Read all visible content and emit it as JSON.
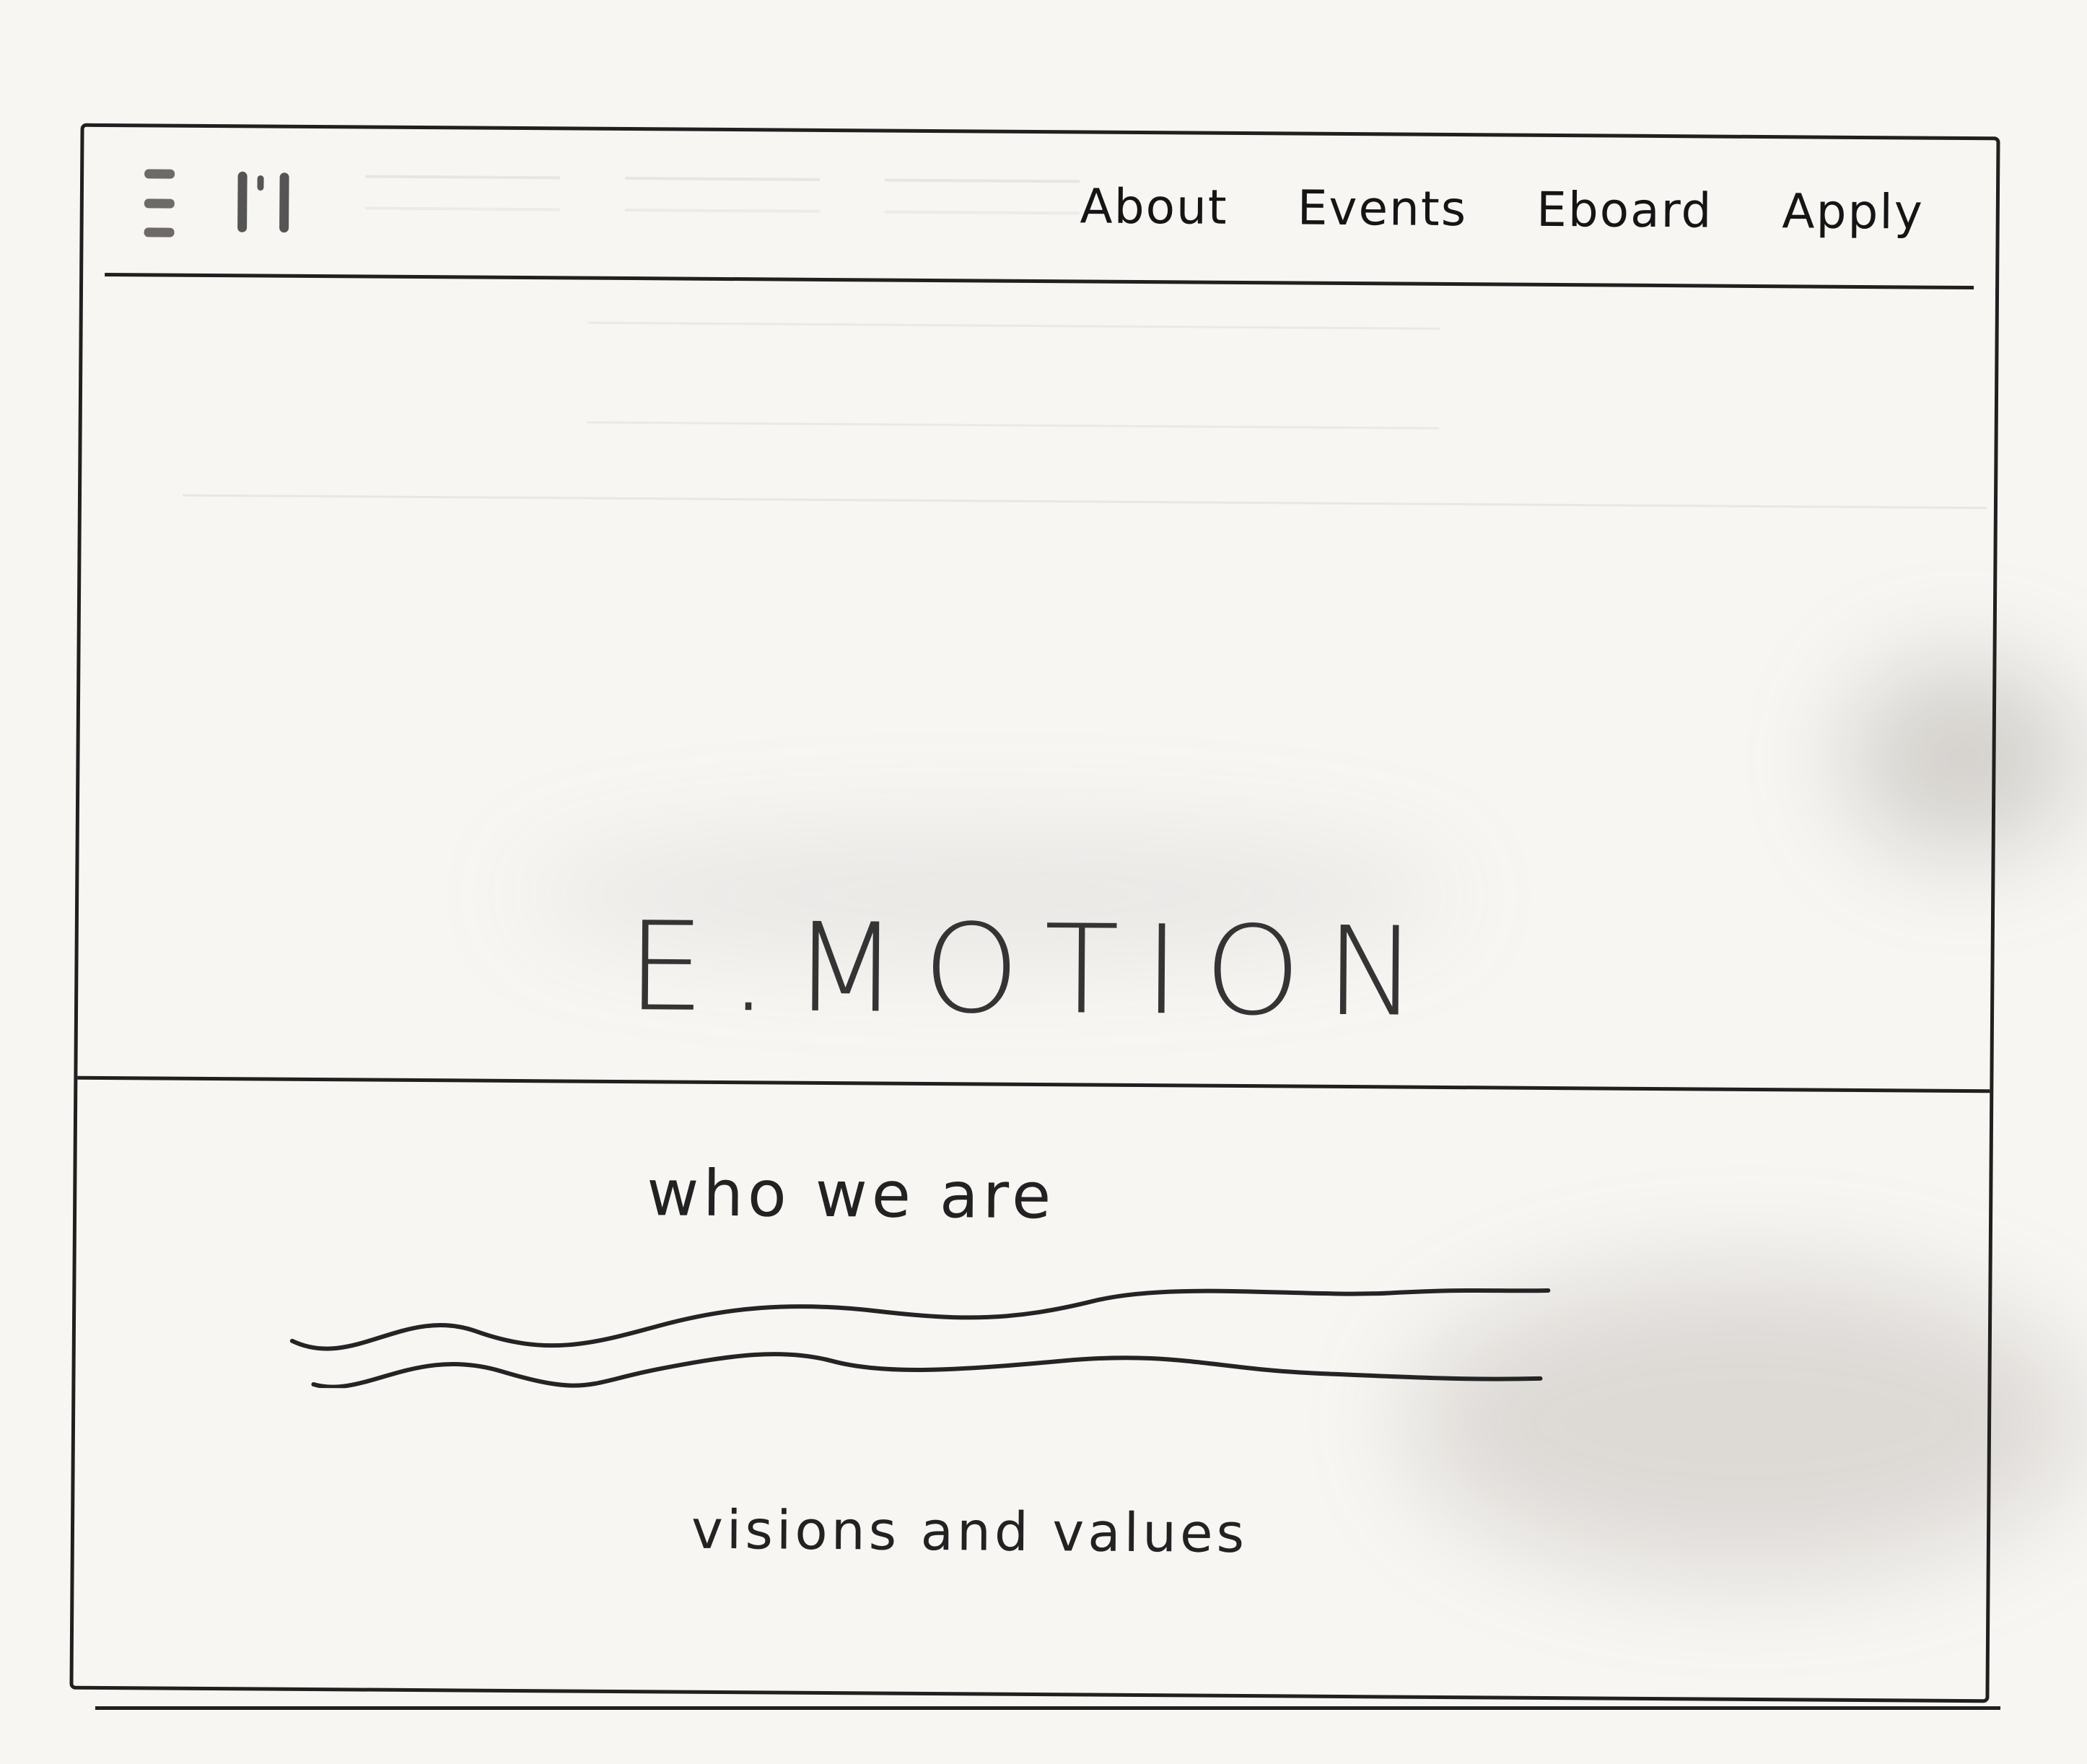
{
  "navbar": {
    "menu_icon": "hamburger-menu-icon",
    "logo_icon": "logo-icon",
    "links": [
      "About",
      "Events",
      "Eboard",
      "Apply"
    ]
  },
  "hero": {
    "title": "E.MOTION"
  },
  "content": {
    "who_heading": "who we are",
    "visions_heading": "visions and values"
  }
}
